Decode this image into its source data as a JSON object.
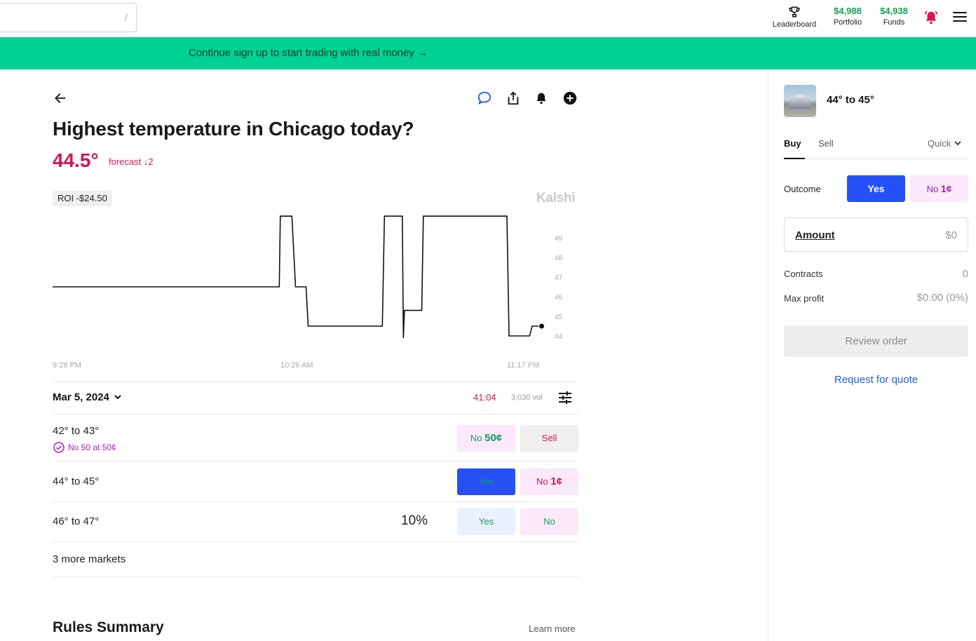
{
  "search": {
    "shortcut": "/"
  },
  "nav": {
    "leaderboard_label": "Leaderboard",
    "portfolio_value": "$4,988",
    "portfolio_label": "Portfolio",
    "funds_value": "$4,938",
    "funds_label": "Funds"
  },
  "banner": {
    "text": "Continue sign up to start trading with real money →"
  },
  "market": {
    "title": "Highest temperature in Chicago today?",
    "forecast_value": "44.5°",
    "forecast_label": "forecast ↓2",
    "roi": "ROI -$24.50",
    "brand": "Kalshi",
    "date": "Mar 5, 2024",
    "timer": "41:04",
    "volume": "3,030 vol",
    "more_markets": "3 more markets",
    "rules_title": "Rules Summary",
    "learn_more": "Learn more"
  },
  "rows": [
    {
      "label": "42° to 43°",
      "position": "No 50 at 50¢",
      "btn1_prefix": "No",
      "btn1_price": "50¢",
      "btn2": "Sell"
    },
    {
      "label": "44° to 45°",
      "btn1": "Yes",
      "btn2_prefix": "No",
      "btn2_price": "1¢"
    },
    {
      "label": "46° to 47°",
      "chance": "10%",
      "btn1": "Yes",
      "btn2": "No"
    }
  ],
  "order_panel": {
    "title": "44° to 45°",
    "tabs": [
      "Buy",
      "Sell"
    ],
    "mode": "Quick",
    "outcome_label": "Outcome",
    "yes_label": "Yes",
    "no_prefix": "No",
    "no_price": "1¢",
    "amount_label": "Amount",
    "amount_value": "$0",
    "contracts_label": "Contracts",
    "contracts_value": "0",
    "max_profit_label": "Max profit",
    "max_profit_value": "$0.00 (0%)",
    "review_label": "Review order",
    "rfq_label": "Request for quote"
  },
  "colors": {
    "accent_green": "#00d294",
    "yes_blue": "#2450f5",
    "no_pink": "#fbe8fb",
    "forecast_red": "#d4145a"
  },
  "chart_data": {
    "type": "line",
    "x_labels": [
      "9:28 PM",
      "10:26 AM",
      "11:17 PM"
    ],
    "y_ticks": [
      44,
      45,
      46,
      47,
      48,
      49
    ],
    "series": [
      {
        "values": [
          46.5,
          46.5,
          50.1,
          50.1,
          46.5,
          46.5,
          44.5,
          44.5,
          50.1,
          50.1,
          43.9,
          45.3,
          45.3,
          50.1,
          50.1,
          44.0,
          44.0,
          44.5,
          44.5
        ],
        "x": [
          0,
          0.431,
          0.433,
          0.455,
          0.462,
          0.482,
          0.486,
          0.627,
          0.631,
          0.665,
          0.667,
          0.669,
          0.702,
          0.705,
          0.864,
          0.868,
          0.907,
          0.912,
          0.93
        ]
      }
    ]
  }
}
